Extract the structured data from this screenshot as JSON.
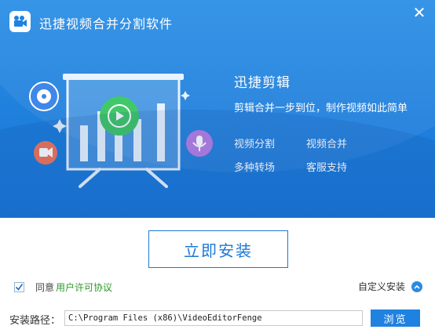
{
  "window": {
    "title": "迅捷视频合并分割软件",
    "close_glyph": "✕"
  },
  "hero": {
    "headline": "迅捷剪辑",
    "subline": "剪辑合并一步到位，制作视频如此简单",
    "features": [
      "视频分割",
      "视频合并",
      "多种转场",
      "客服支持"
    ]
  },
  "install_button": "立即安装",
  "agreement": {
    "prefix": "同意",
    "link": "用户许可协议",
    "checked": true
  },
  "custom_install": "自定义安装",
  "path": {
    "label": "安装路径：",
    "value": "C:\\Program Files (x86)\\VideoEditorFenge"
  },
  "browse_button": "浏览",
  "colors": {
    "accent": "#1f82e0",
    "link_green": "#2a9a2a"
  }
}
